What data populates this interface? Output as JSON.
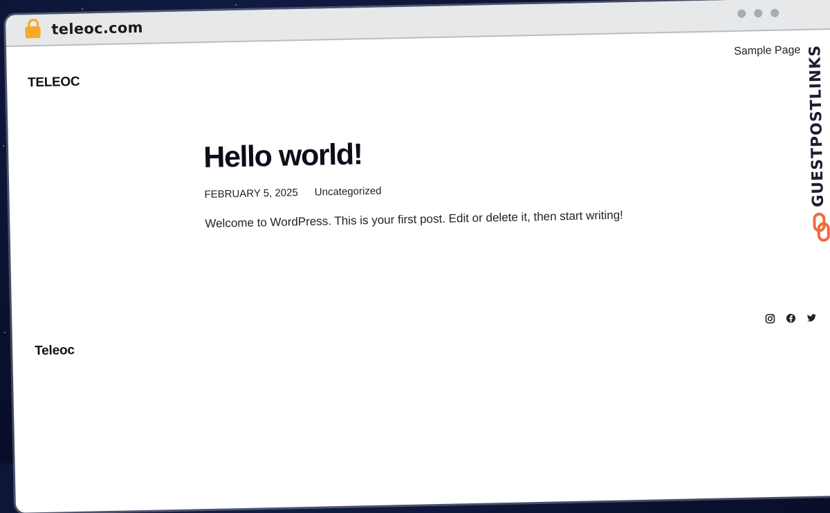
{
  "browser": {
    "url": "teleoc.com",
    "icons": {
      "lock": "lock-icon",
      "window_controls": [
        "dot",
        "dot",
        "dot"
      ]
    }
  },
  "site": {
    "title": "TELEOC",
    "nav": [
      {
        "label": "Sample Page"
      }
    ]
  },
  "post": {
    "title": "Hello world!",
    "date": "FEBRUARY 5, 2025",
    "category": "Uncategorized",
    "excerpt": "Welcome to WordPress. This is your first post. Edit or delete it, then start writing!"
  },
  "footer": {
    "title": "Teleoc",
    "social": [
      "instagram-icon",
      "facebook-icon",
      "twitter-icon"
    ]
  },
  "watermark": {
    "text": "GUESTPOSTLINKS",
    "accent": "#f26b3a"
  }
}
